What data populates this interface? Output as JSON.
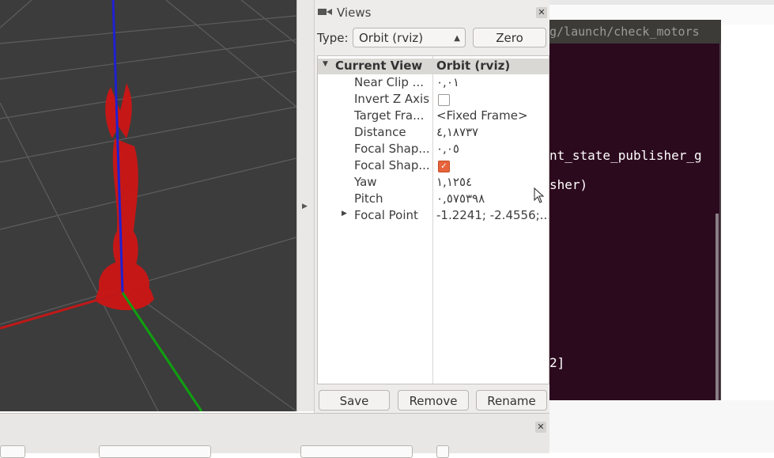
{
  "views_panel": {
    "title": "Views",
    "type_label": "Type:",
    "type_value": "Orbit (rviz)",
    "zero_button": "Zero",
    "tree": {
      "header_name": "Current View",
      "header_value": "Orbit (rviz)",
      "rows": [
        {
          "name": "Near Clip ...",
          "value": "٠,٠١"
        },
        {
          "name": "Invert Z Axis",
          "checked": false
        },
        {
          "name": "Target Fra...",
          "value": "<Fixed Frame>"
        },
        {
          "name": "Distance",
          "value": "٤,١٨٧٣٧"
        },
        {
          "name": "Focal Shap...",
          "value": "٠,٠٥"
        },
        {
          "name": "Focal Shap...",
          "checked": true
        },
        {
          "name": "Yaw",
          "value": "١,١٢٥٤"
        },
        {
          "name": "Pitch",
          "value": "٠,٥٧٥٣٩٨"
        },
        {
          "name": "Focal Point",
          "value": "-1.2241; -2.4556;..."
        }
      ]
    },
    "buttons": {
      "save": "Save",
      "remove": "Remove",
      "rename": "Rename"
    }
  },
  "terminal": {
    "title": "g/launch/check_motors",
    "lines": [
      "nt_state_publisher_g",
      "sher)",
      "2]"
    ]
  },
  "colors": {
    "viewport_bg": "#3c3c3c",
    "grid": "#5a5a5a",
    "robot": "#d01010",
    "axis_z": "#2020d0",
    "axis_x": "#c01818",
    "axis_y": "#10a010",
    "terminal_bg": "#2c0a1e",
    "checkbox_on": "#e7643c"
  }
}
